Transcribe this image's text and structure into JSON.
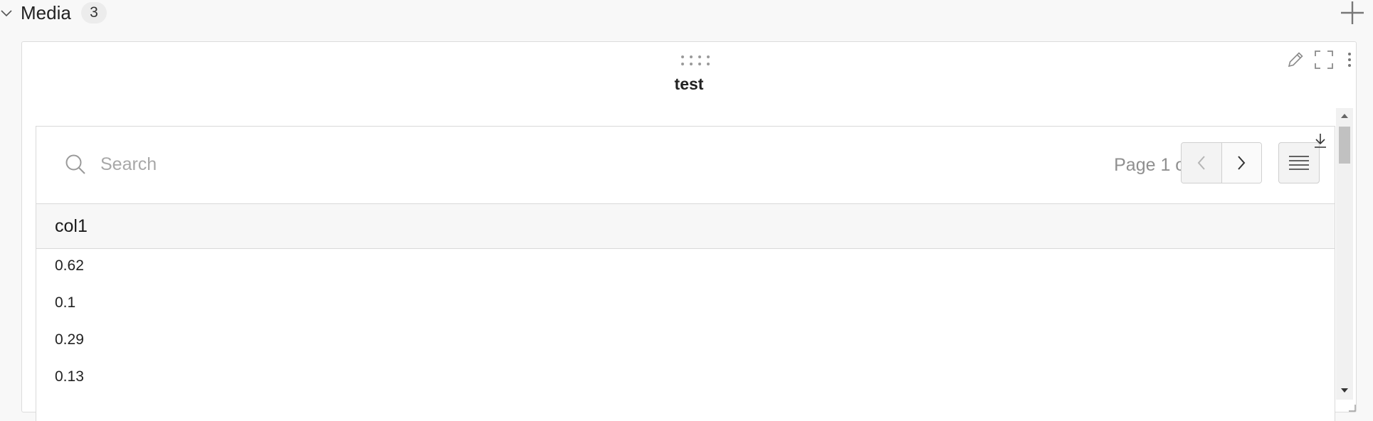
{
  "section": {
    "title": "Media",
    "count": "3"
  },
  "panel": {
    "title": "test"
  },
  "table": {
    "search_placeholder": "Search",
    "search_value": "",
    "page_info": "Page 1 of 2",
    "columns": [
      "col1"
    ],
    "rows": [
      "0.62",
      "0.1",
      "0.29",
      "0.13"
    ]
  },
  "icons": {
    "collapse": "chevron-down-icon",
    "add": "plus-icon",
    "drag": "drag-handle-icon",
    "edit": "pencil-icon",
    "fullscreen": "fullscreen-icon",
    "more": "more-vertical-icon",
    "search": "search-icon",
    "prev": "chevron-left-icon",
    "next": "chevron-right-icon",
    "columns": "menu-lines-icon",
    "download": "download-icon"
  }
}
